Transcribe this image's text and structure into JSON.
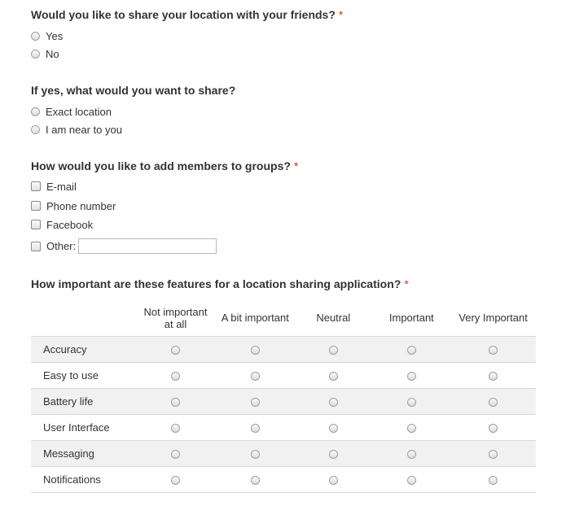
{
  "q1": {
    "title": "Would you like to share your location with your friends?",
    "required_mark": "*",
    "options": [
      "Yes",
      "No"
    ]
  },
  "q2": {
    "title": "If yes, what would you want to share?",
    "options": [
      "Exact location",
      "I am near to you"
    ]
  },
  "q3": {
    "title": "How would you like to add members to groups?",
    "required_mark": "*",
    "options": [
      "E-mail",
      "Phone number",
      "Facebook",
      "Other:"
    ],
    "other_value": ""
  },
  "q4": {
    "title": "How important are these features for a location sharing application?",
    "required_mark": "*",
    "columns": [
      "Not important at all",
      "A bit important",
      "Neutral",
      "Important",
      "Very Important"
    ],
    "rows": [
      "Accuracy",
      "Easy to use",
      "Battery life",
      "User Interface",
      "Messaging",
      "Notifications"
    ]
  },
  "colors": {
    "required": "#c43b1d",
    "row_shade": "#f1f1f1",
    "divider": "#d8d8d8"
  }
}
